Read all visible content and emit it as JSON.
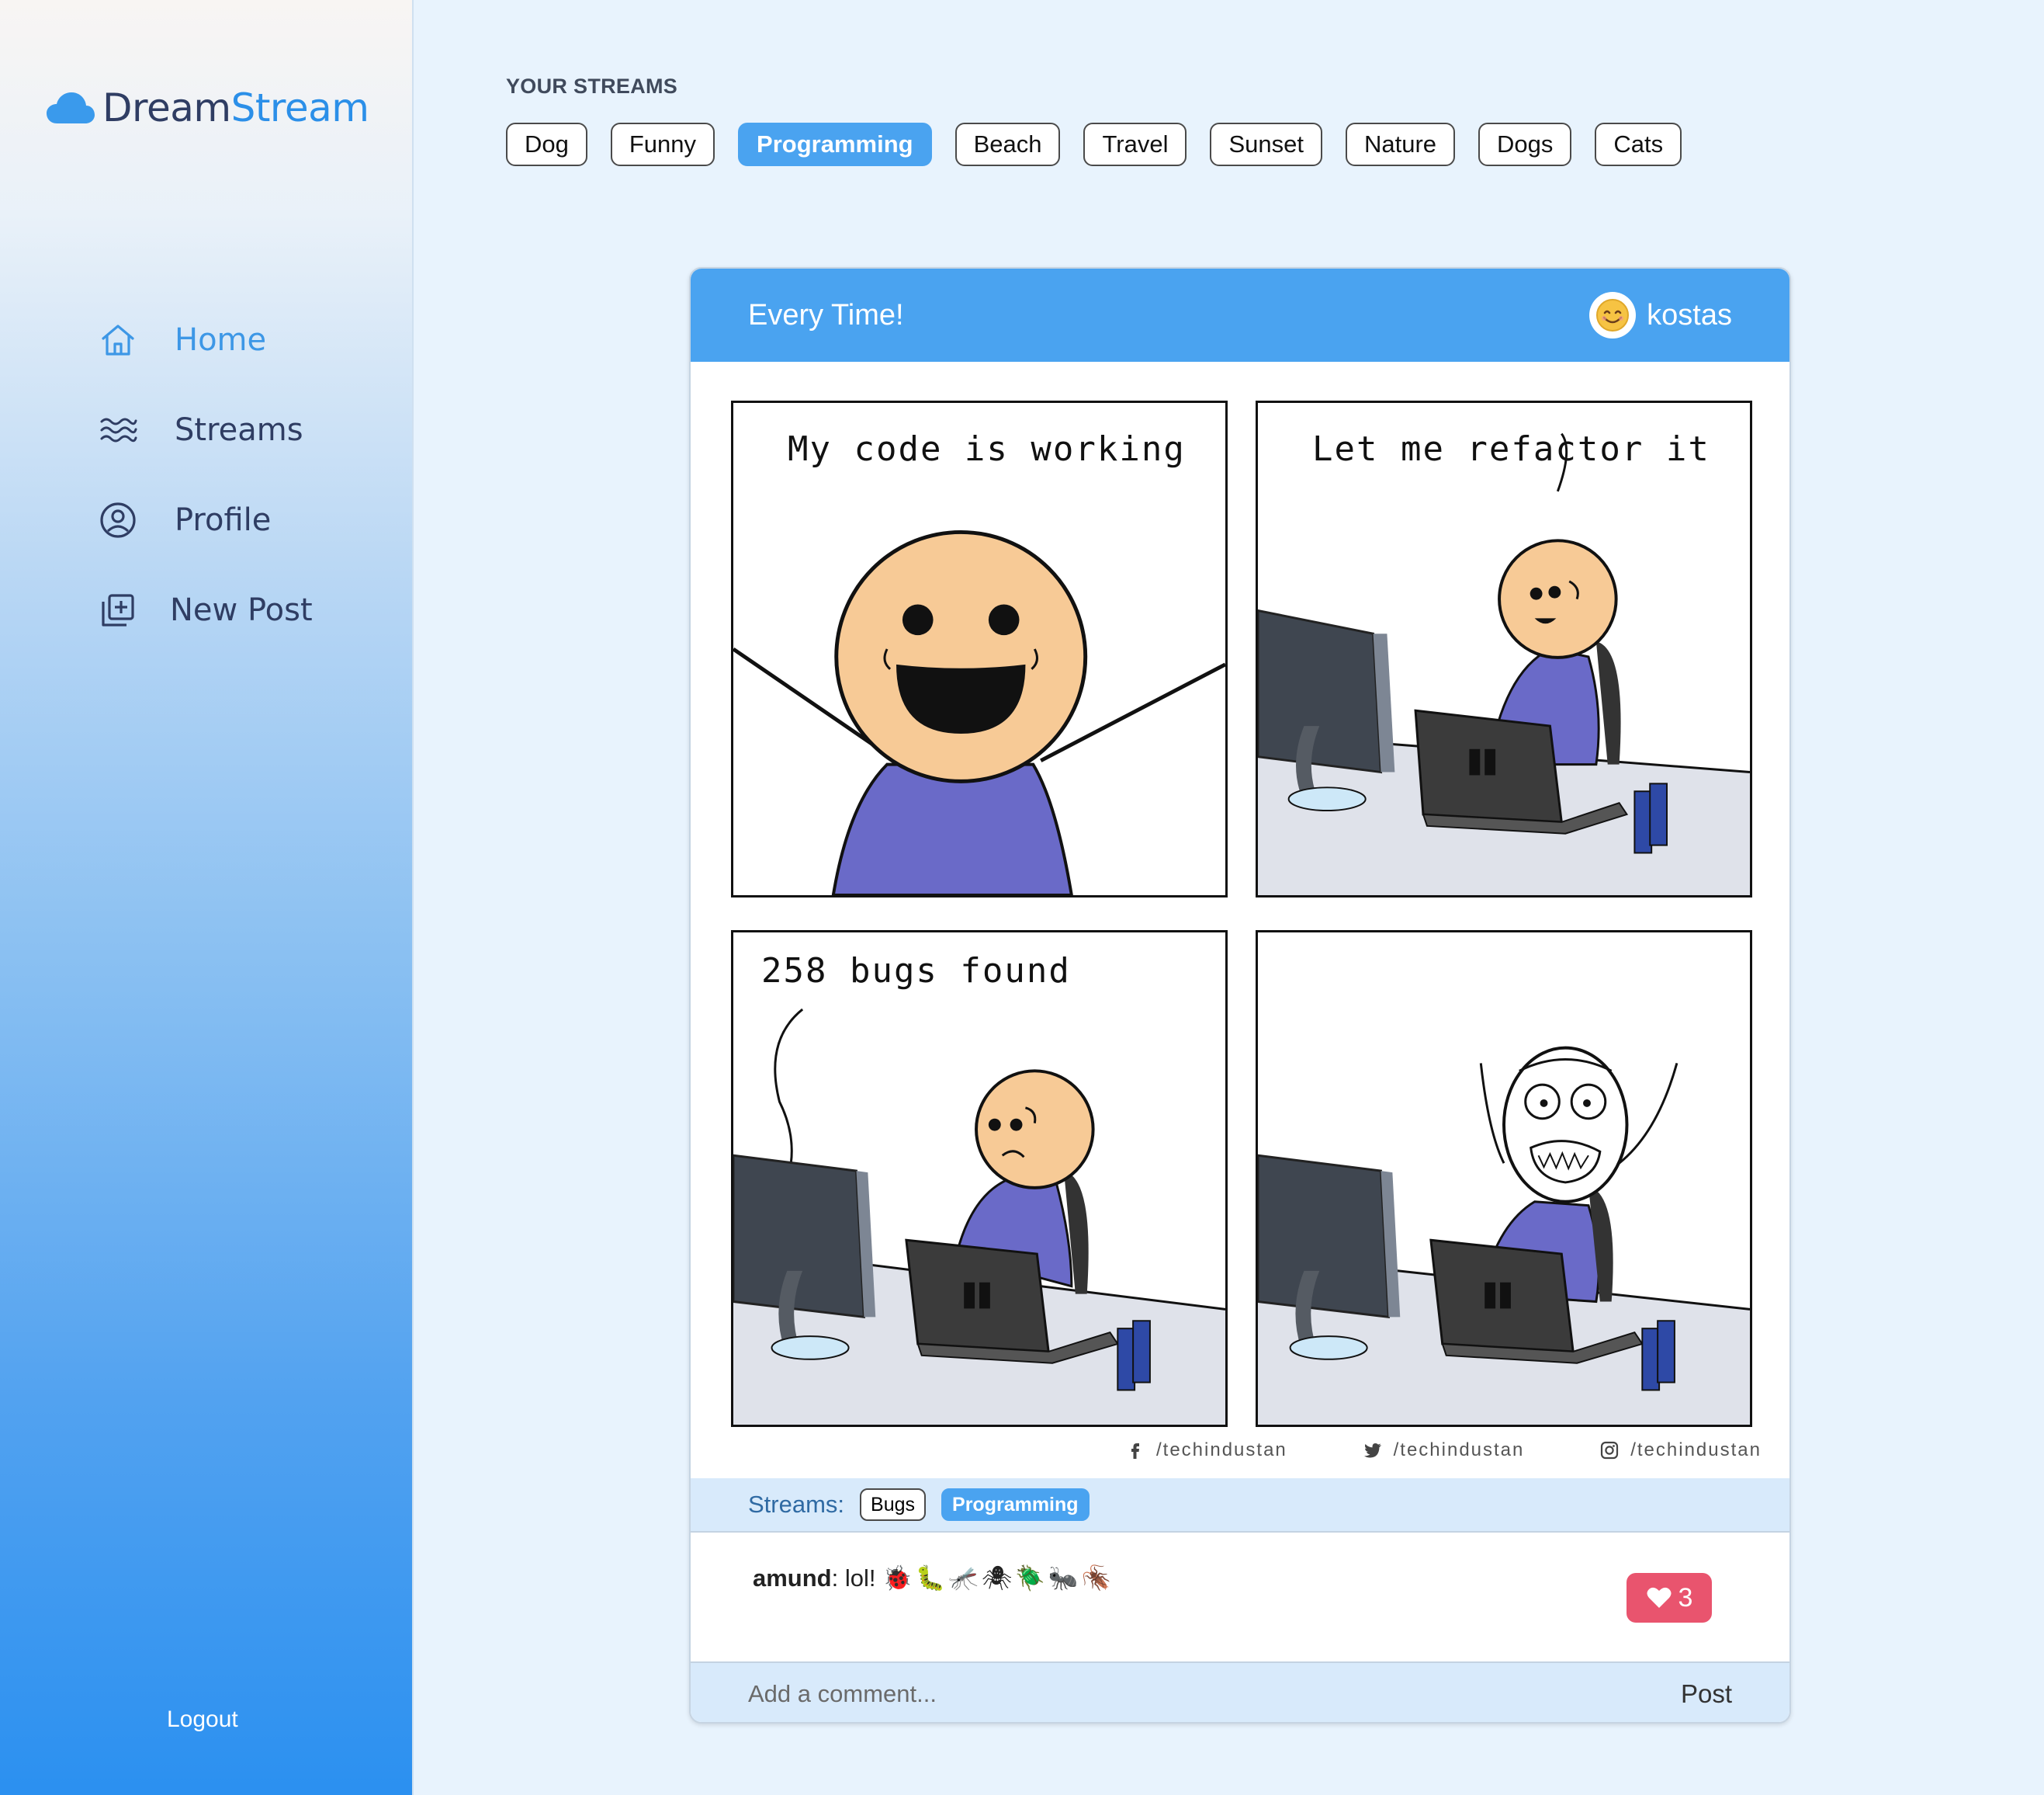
{
  "brand": {
    "part1": "Dream",
    "part2": "Stream"
  },
  "nav": {
    "home": "Home",
    "streams": "Streams",
    "profile": "Profile",
    "new_post": "New Post",
    "logout": "Logout"
  },
  "your_streams": {
    "heading": "YOUR STREAMS",
    "chips": [
      "Dog",
      "Funny",
      "Programming",
      "Beach",
      "Travel",
      "Sunset",
      "Nature",
      "Dogs",
      "Cats"
    ],
    "selected": "Programming"
  },
  "post": {
    "title": "Every Time!",
    "author": "kostas",
    "comic": {
      "panel1": "My code is working",
      "panel2": "Let me refactor it",
      "panel3": "258 bugs found",
      "credits": [
        "/techindustan",
        "/techindustan",
        "/techindustan"
      ]
    },
    "streams_label": "Streams:",
    "tags": [
      "Bugs",
      "Programming"
    ],
    "comment": {
      "user": "amund",
      "text": ": lol! ",
      "emoji": "🐞🐛🦟🕷🪲🐜🪳"
    },
    "likes": "3",
    "comment_placeholder": "Add a comment...",
    "post_button": "Post"
  },
  "colors": {
    "accent": "#4aa3f0",
    "like": "#e9546e",
    "navy": "#2f3d63"
  }
}
